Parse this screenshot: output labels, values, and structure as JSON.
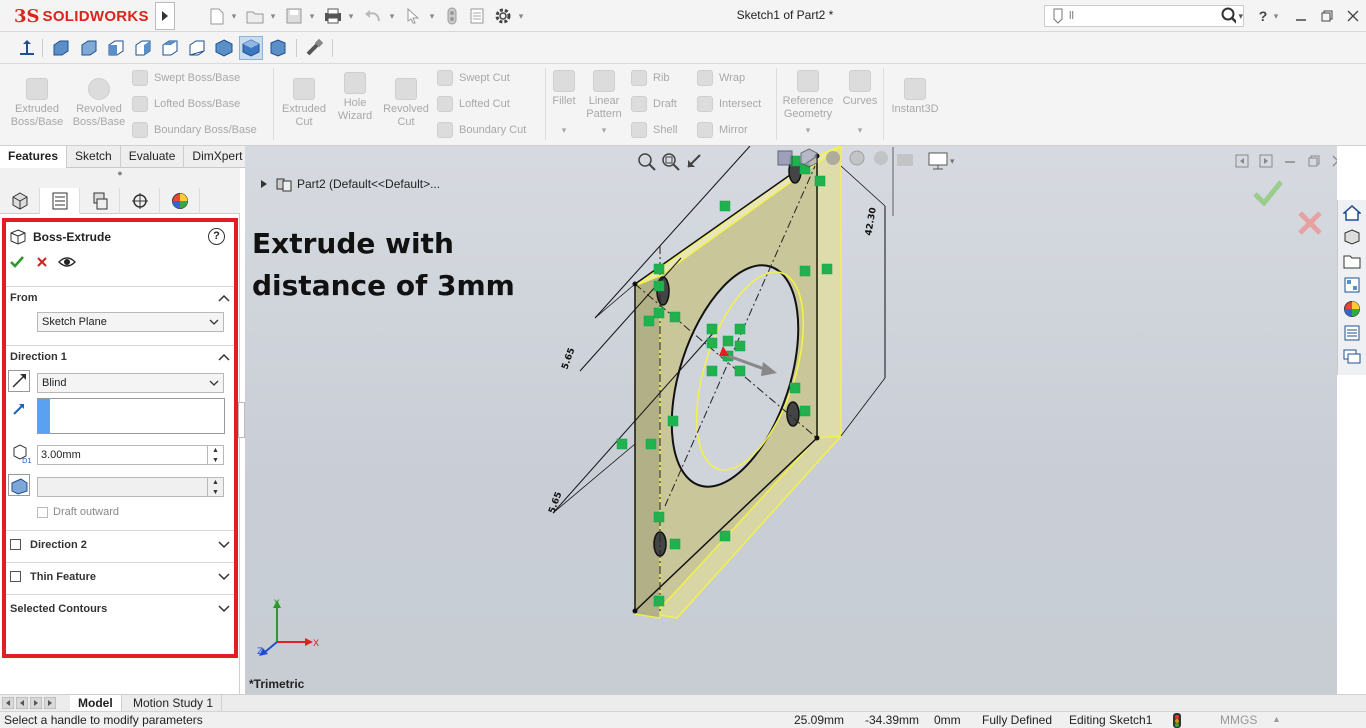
{
  "app": {
    "brand_prefix": "3S",
    "brand_name": "SOLIDWORKS",
    "document_title": "Sketch1 of Part2 *",
    "search_placeholder": "ll"
  },
  "command_manager": {
    "features": [
      {
        "label_line1": "Extruded",
        "label_line2": "Boss/Base",
        "icon": "extruded-boss-icon"
      },
      {
        "label_line1": "Revolved",
        "label_line2": "Boss/Base",
        "icon": "revolved-boss-icon"
      }
    ],
    "boss_small": [
      "Swept Boss/Base",
      "Lofted Boss/Base",
      "Boundary Boss/Base"
    ],
    "cut_big": [
      {
        "label_line1": "Extruded",
        "label_line2": "Cut"
      },
      {
        "label_line1": "Hole",
        "label_line2": "Wizard"
      },
      {
        "label_line1": "Revolved",
        "label_line2": "Cut"
      }
    ],
    "cut_small": [
      "Swept Cut",
      "Lofted Cut",
      "Boundary Cut"
    ],
    "fillet": "Fillet",
    "linear_pattern_line1": "Linear",
    "linear_pattern_line2": "Pattern",
    "mid_small": [
      "Rib",
      "Draft",
      "Shell"
    ],
    "right_small": [
      "Wrap",
      "Intersect",
      "Mirror"
    ],
    "reference_line1": "Reference",
    "reference_line2": "Geometry",
    "curves": "Curves",
    "instant3d": "Instant3D"
  },
  "tabs": [
    "Features",
    "Sketch",
    "Evaluate",
    "DimXpert"
  ],
  "active_tab": "Features",
  "property_manager": {
    "title": "Boss-Extrude",
    "help_icon": "?",
    "from_label": "From",
    "from_value": "Sketch Plane",
    "direction1_label": "Direction 1",
    "end_condition": "Blind",
    "depth_value": "3.00mm",
    "draft_outward": "Draft outward",
    "direction2_label": "Direction 2",
    "thin_feature_label": "Thin Feature",
    "selected_contours_label": "Selected Contours"
  },
  "viewport": {
    "annotation_line1": "Extrude with",
    "annotation_line2": "distance of 3mm",
    "tree_root": "Part2  (Default<<Default>...",
    "view_name": "*Trimetric",
    "dimensions": [
      "5.65",
      "5.65",
      "42.30"
    ],
    "triad_labels": [
      "Y",
      "X",
      "Z"
    ]
  },
  "bottom_tabs": [
    "Model",
    "Motion Study 1"
  ],
  "status_bar": {
    "message": "Select a handle to modify parameters",
    "x": "25.09mm",
    "y": "-34.39mm",
    "z": "0mm",
    "definition": "Fully Defined",
    "editing": "Editing Sketch1",
    "units": "MMGS"
  },
  "colors": {
    "brand_red": "#d9261c",
    "highlight_red": "#e01e24",
    "model_face": "#c9c79a",
    "sketch_yellow": "#f2f24a",
    "relation_green": "#22b14c"
  }
}
